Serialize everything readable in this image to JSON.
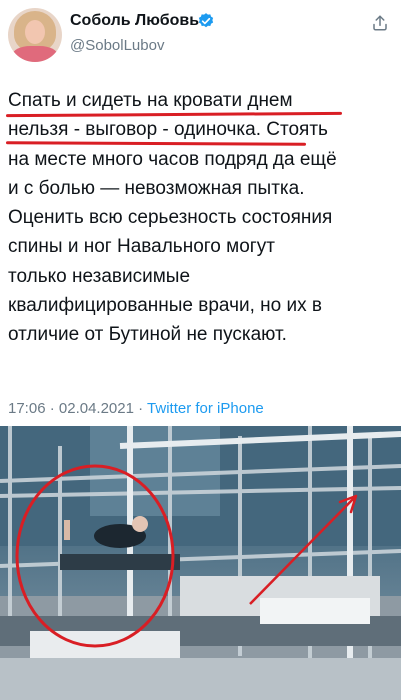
{
  "tweet": {
    "author_name": "Соболь Любовь",
    "author_handle": "@SobolLubov",
    "lines": [
      "Спать и сидеть на кровати днем",
      "нельзя - выговор - одиночка. Стоять",
      "на месте много часов подряд да ещё",
      "и с болью — невозможная пытка.",
      "Оценить всю серьезность состояния",
      "спины и ног Навального могут",
      "только независимые",
      "квалифицированные врачи, но их в",
      "отличие от Бутиной не пускают."
    ],
    "time": "17:06",
    "separator1": " · ",
    "date": "02.04.2021",
    "separator2": " · ",
    "source": "Twitter for iPhone"
  },
  "icons": {
    "verified": "verified-badge-icon",
    "share": "share-icon"
  },
  "colors": {
    "text": "#0f1419",
    "secondary": "#6b7a86",
    "link": "#1d9bf0",
    "verified": "#1d9bf0",
    "annotation_red": "#d91e24"
  }
}
